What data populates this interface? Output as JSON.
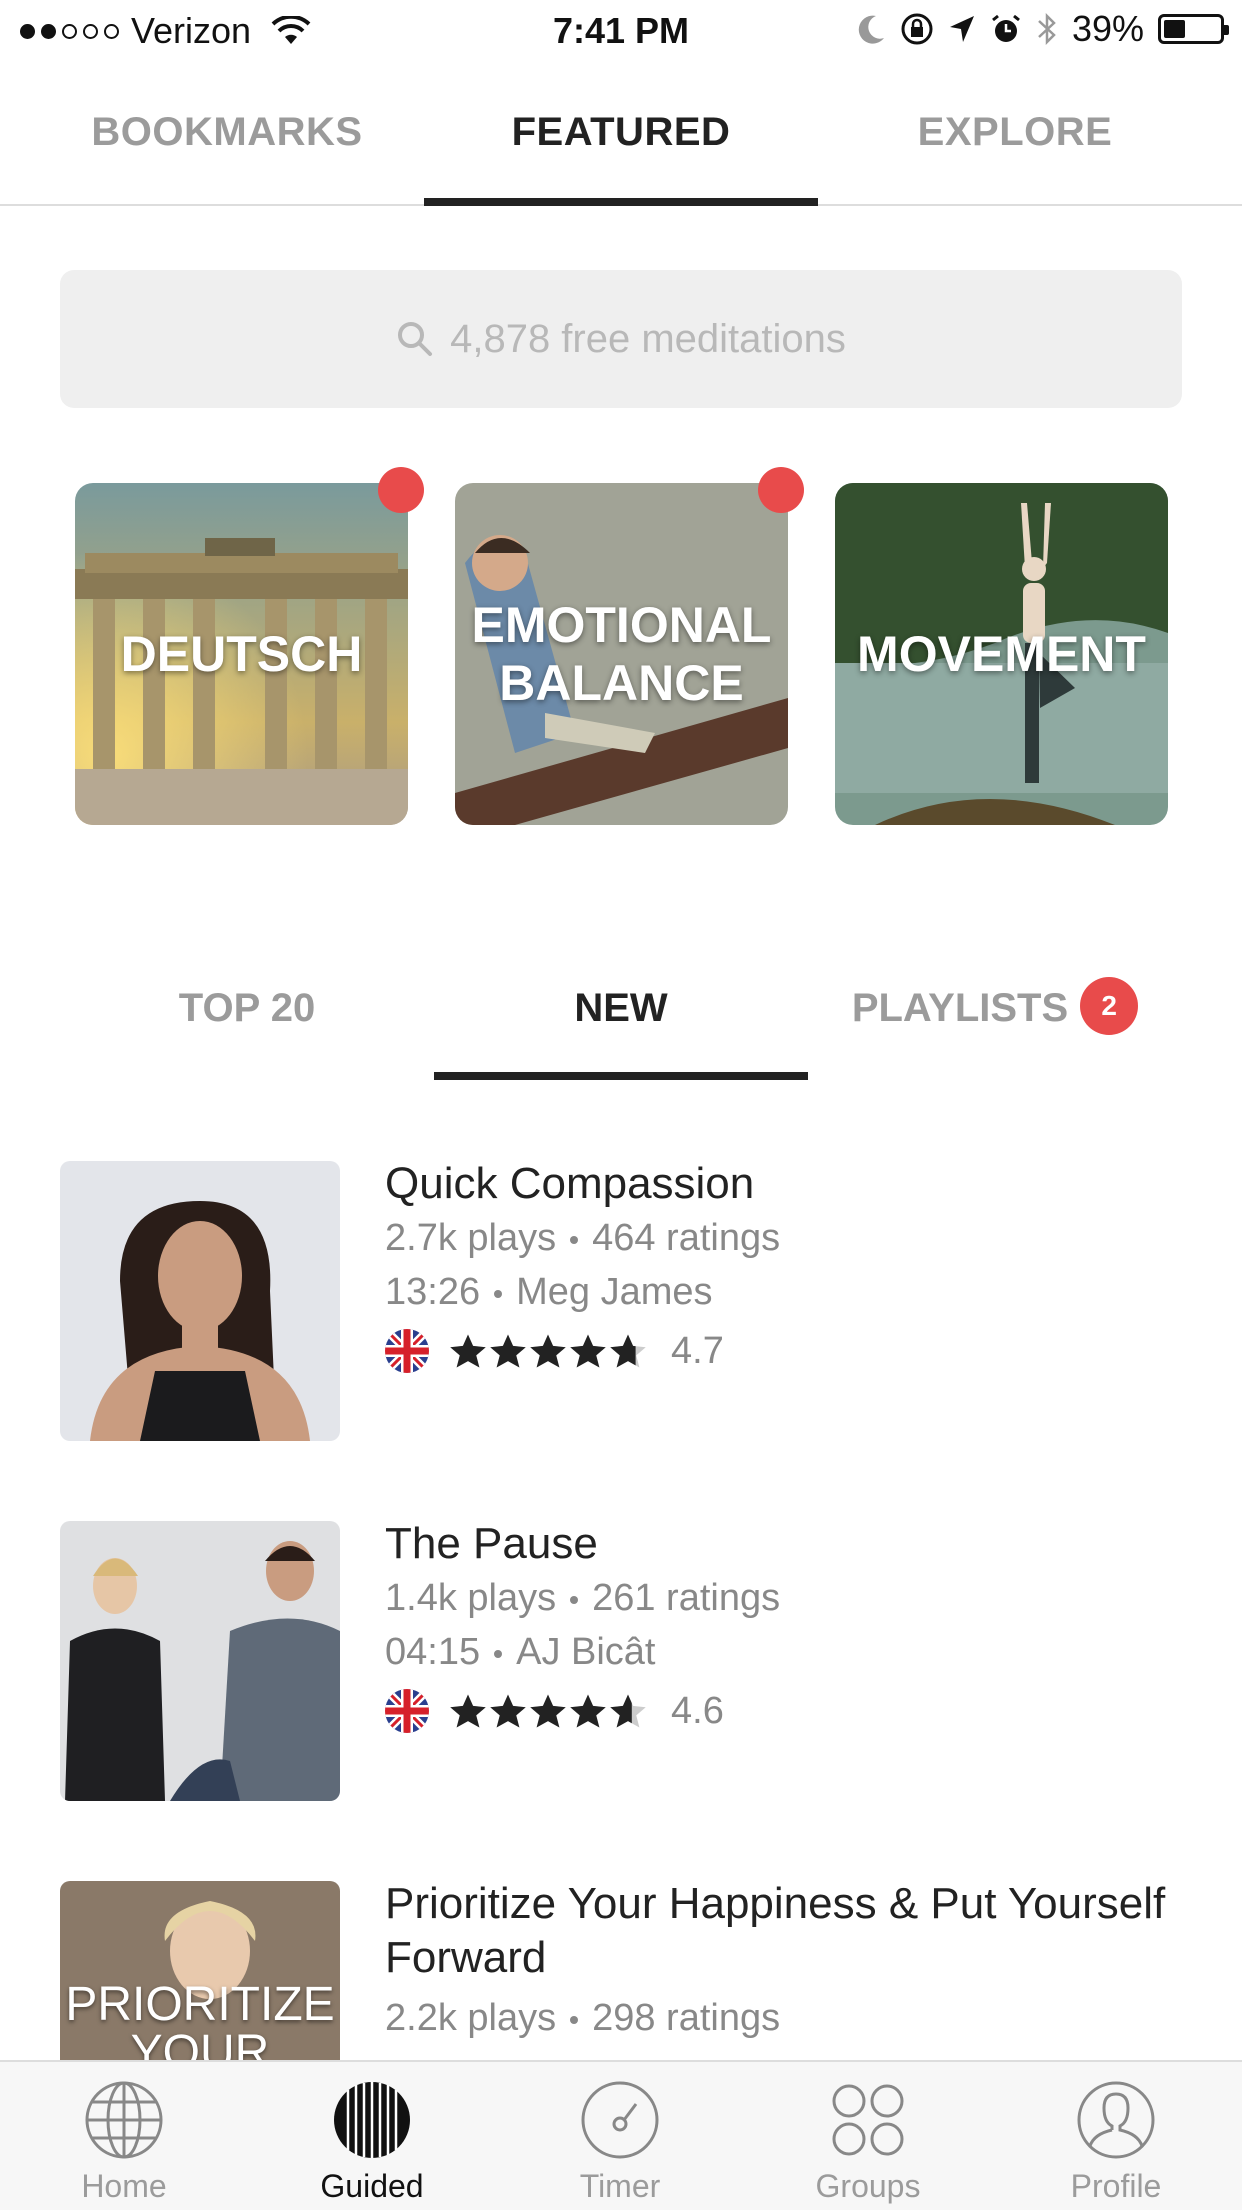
{
  "status_bar": {
    "carrier": "Verizon",
    "time": "7:41 PM",
    "battery": "39%",
    "battery_level": 0.39
  },
  "top_tabs": [
    {
      "label": "BOOKMARKS",
      "active": false
    },
    {
      "label": "FEATURED",
      "active": true
    },
    {
      "label": "EXPLORE",
      "active": false
    }
  ],
  "search": {
    "placeholder": "4,878 free meditations"
  },
  "feature_cards": [
    {
      "label": "DEUTSCH",
      "has_badge": true
    },
    {
      "label": "EMOTIONAL BALANCE",
      "has_badge": true
    },
    {
      "label": "MOVEMENT",
      "has_badge": false
    }
  ],
  "sub_tabs": [
    {
      "label": "TOP 20",
      "active": false
    },
    {
      "label": "NEW",
      "active": true
    },
    {
      "label": "PLAYLISTS",
      "active": false,
      "badge": "2"
    }
  ],
  "items": [
    {
      "title": "Quick Compassion",
      "plays": "2.7k plays",
      "ratings": "464 ratings",
      "duration": "13:26",
      "author": "Meg James",
      "rating": "4.7",
      "rating_value": 4.7
    },
    {
      "title": "The Pause",
      "plays": "1.4k plays",
      "ratings": "261 ratings",
      "duration": "04:15",
      "author": "AJ Bicât",
      "rating": "4.6",
      "rating_value": 4.6
    },
    {
      "title": "Prioritize Your Happiness & Put Yourself Forward",
      "plays": "2.2k plays",
      "ratings": "298 ratings",
      "thumb_text": "PRIORITIZE YOUR"
    }
  ],
  "bottom_nav": [
    {
      "label": "Home",
      "icon": "globe-icon",
      "active": false
    },
    {
      "label": "Guided",
      "icon": "guided-icon",
      "active": true
    },
    {
      "label": "Timer",
      "icon": "timer-icon",
      "active": false
    },
    {
      "label": "Groups",
      "icon": "groups-icon",
      "active": false
    },
    {
      "label": "Profile",
      "icon": "profile-icon",
      "active": false
    }
  ]
}
